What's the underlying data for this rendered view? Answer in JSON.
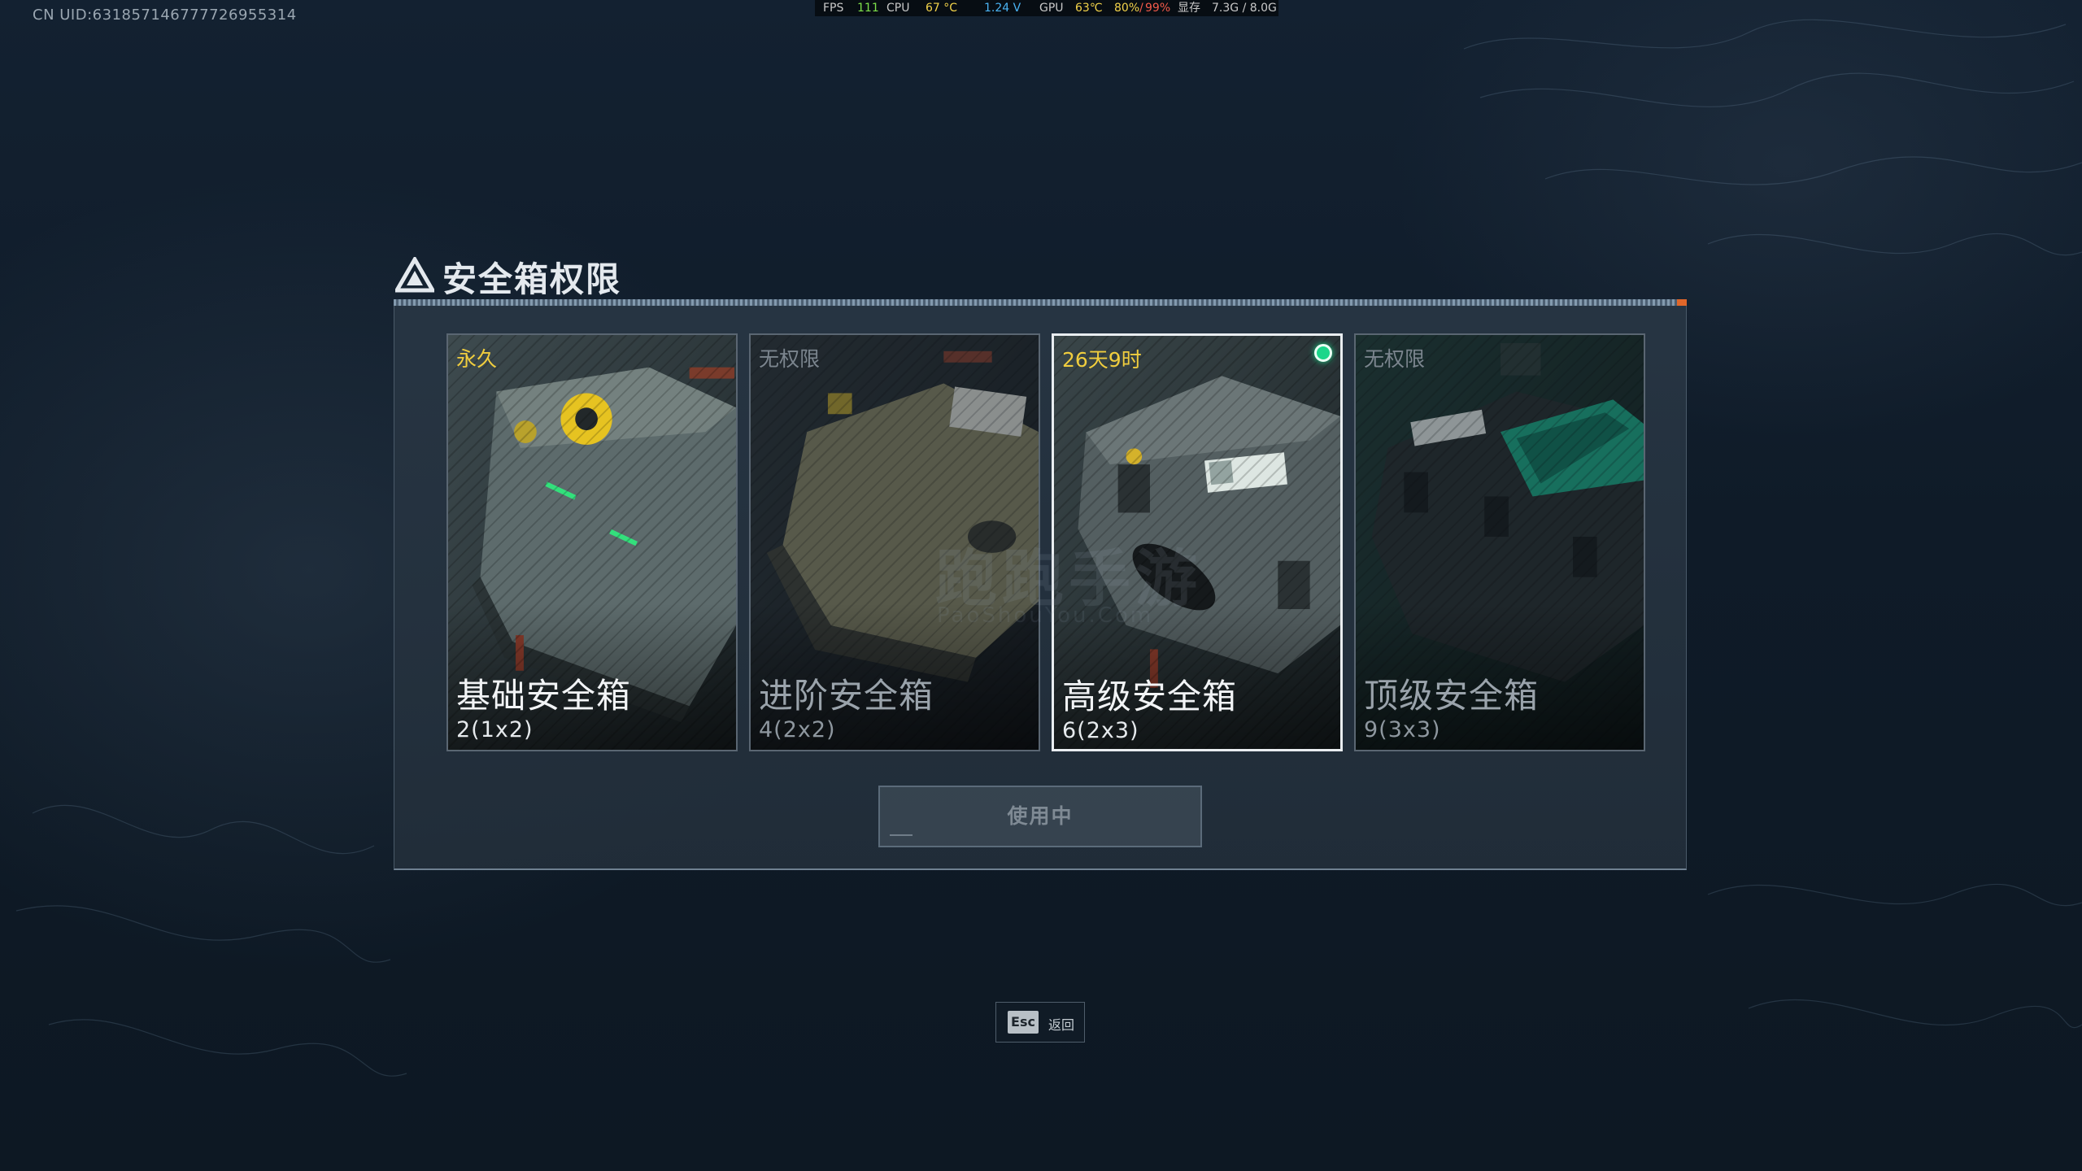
{
  "uid": "CN UID:631857146777726955314",
  "perf": {
    "fps_label": "FPS",
    "fps_value": "111",
    "cpu_label": "CPU",
    "cpu_temp": "67 °C",
    "cpu_volt": "1.24 V",
    "gpu_label": "GPU",
    "gpu_temp": "63℃",
    "gpu_usage_a": "80%",
    "gpu_usage_sep": "/",
    "gpu_usage_b": "99%",
    "vram_label": "显存",
    "vram_value": "7.3G / 8.0G"
  },
  "panel": {
    "title": "安全箱权限",
    "action_button": "使用中"
  },
  "cards": [
    {
      "status": "永久",
      "name": "基础安全箱",
      "capacity": "2(1x2)",
      "locked": false,
      "selected": false
    },
    {
      "status": "无权限",
      "name": "进阶安全箱",
      "capacity": "4(2x2)",
      "locked": true,
      "selected": false
    },
    {
      "status": "26天9时",
      "name": "高级安全箱",
      "capacity": "6(2x3)",
      "locked": false,
      "selected": true
    },
    {
      "status": "无权限",
      "name": "顶级安全箱",
      "capacity": "9(3x3)",
      "locked": true,
      "selected": false
    }
  ],
  "footer": {
    "esc_key": "Esc",
    "esc_label": "返回"
  },
  "watermark": {
    "main": "跑跑手游",
    "sub": "PaoShouYou.Com"
  },
  "colors": {
    "accent_gold": "#f0cd3e",
    "active_green": "#1bd68a",
    "header_cap": "#e0672a"
  }
}
